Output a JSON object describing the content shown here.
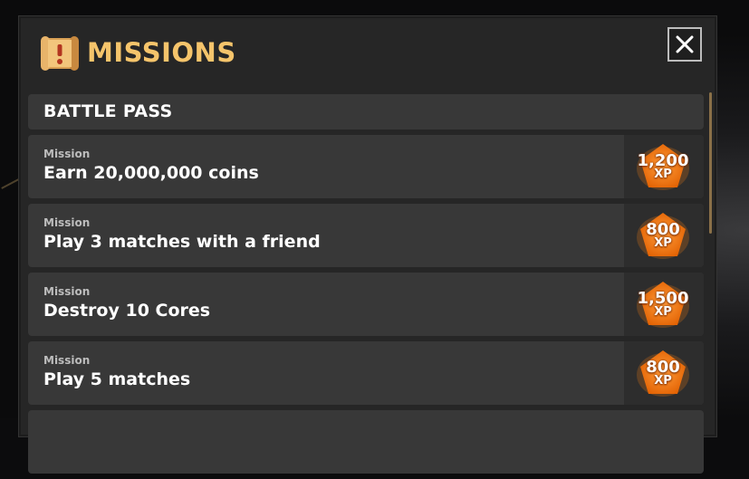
{
  "header": {
    "title": "MISSIONS",
    "close_label": "×"
  },
  "section": {
    "title": "BATTLE PASS"
  },
  "missions": [
    {
      "label": "Mission",
      "text": "Earn 20,000,000 coins",
      "xp": "1,200",
      "xp_unit": "XP"
    },
    {
      "label": "Mission",
      "text": "Play 3 matches with a friend",
      "xp": "800",
      "xp_unit": "XP"
    },
    {
      "label": "Mission",
      "text": "Destroy 10 Cores",
      "xp": "1,500",
      "xp_unit": "XP"
    },
    {
      "label": "Mission",
      "text": "Play 5 matches",
      "xp": "800",
      "xp_unit": "XP"
    }
  ],
  "colors": {
    "title": "#f5c46b",
    "panel": "#262626",
    "row": "#383838",
    "xp_badge": "#f07a12"
  },
  "icons": {
    "title_icon": "scroll-icon",
    "close_icon": "close-icon",
    "reward_icon": "xp-badge-icon"
  }
}
